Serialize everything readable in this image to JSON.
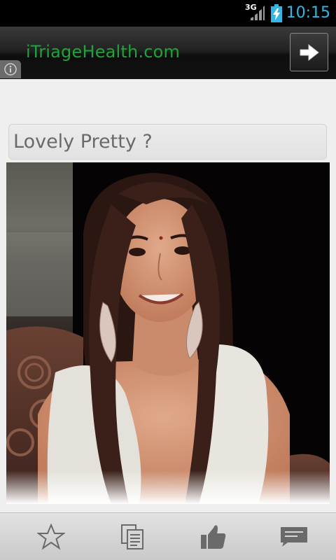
{
  "status_bar": {
    "network_type": "3G",
    "time": "10:15",
    "signal_icon": "signal-bars-icon",
    "battery_icon": "battery-charging-icon",
    "clock_color": "#33b5e5"
  },
  "ad_banner": {
    "text": "iTriageHealth.com",
    "text_color": "#1fa33a",
    "arrow_icon": "arrow-right-icon",
    "info_icon": "info-icon"
  },
  "post": {
    "title": "Lovely Pretty ?",
    "image_description": "portrait-photo"
  },
  "bottom_bar": {
    "buttons": [
      {
        "name": "favorite",
        "icon": "star-icon"
      },
      {
        "name": "copy",
        "icon": "copy-icon"
      },
      {
        "name": "like",
        "icon": "thumbs-up-icon"
      },
      {
        "name": "comment",
        "icon": "comment-icon"
      }
    ]
  }
}
